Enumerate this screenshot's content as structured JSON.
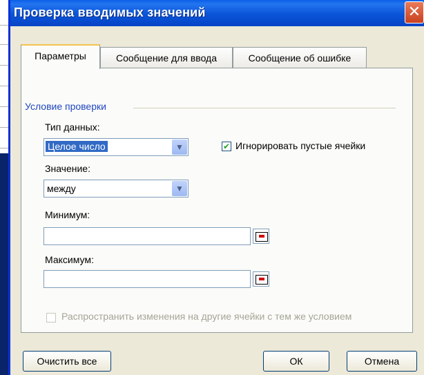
{
  "dialog": {
    "title": "Проверка вводимых значений",
    "close_glyph": "✕"
  },
  "tabs": [
    {
      "label": "Параметры",
      "active": true
    },
    {
      "label": "Сообщение для ввода",
      "active": false
    },
    {
      "label": "Сообщение об ошибке",
      "active": false
    }
  ],
  "criteria": {
    "group_label": "Условие проверки",
    "data_type_label": "Тип данных:",
    "data_type_value": "Целое число",
    "ignore_blank_label": "Игнорировать пустые ячейки",
    "ignore_blank_checked": true,
    "data_label": "Значение:",
    "data_value": "между",
    "minimum_label": "Минимум:",
    "minimum_value": "",
    "maximum_label": "Максимум:",
    "maximum_value": "",
    "apply_all_label": "Распространить изменения на другие ячейки с тем же условием",
    "apply_all_checked": false
  },
  "buttons": {
    "clear_all": "Очистить все",
    "ok": "ОК",
    "cancel": "Отмена"
  },
  "icons": {
    "dropdown": "chevron-down-icon",
    "collapse": "collapse-dialog-icon",
    "check": "✔",
    "arrow_glyph": "▼"
  },
  "colors": {
    "titlebar": "#0a54d8",
    "selection": "#316ac5",
    "group_label": "#1f47c0"
  }
}
